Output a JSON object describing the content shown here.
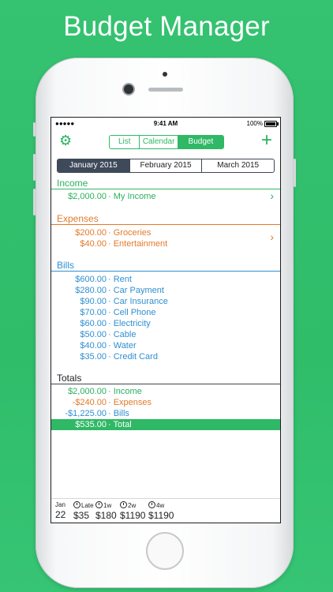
{
  "headline": "Budget Manager",
  "status_bar": {
    "signal": "●●●●● ",
    "time": "9:41 AM",
    "battery": "100%"
  },
  "toolbar": {
    "segments": [
      "List",
      "Calendar",
      "Budget"
    ],
    "active_segment": "Budget",
    "settings_icon": "gear-icon",
    "add_icon": "plus-icon"
  },
  "months": [
    "January 2015",
    "February 2015",
    "March 2015"
  ],
  "active_month": "January 2015",
  "income": {
    "title": "Income",
    "items": [
      {
        "amount": "$2,000.00",
        "label": "· My Income"
      }
    ]
  },
  "expenses": {
    "title": "Expenses",
    "items": [
      {
        "amount": "$200.00",
        "label": "· Groceries"
      },
      {
        "amount": "$40.00",
        "label": "· Entertainment"
      }
    ]
  },
  "bills": {
    "title": "Bills",
    "items": [
      {
        "amount": "$600.00",
        "label": "· Rent"
      },
      {
        "amount": "$280.00",
        "label": "· Car Payment"
      },
      {
        "amount": "$90.00",
        "label": "· Car Insurance"
      },
      {
        "amount": "$70.00",
        "label": "· Cell Phone"
      },
      {
        "amount": "$60.00",
        "label": "· Electricity"
      },
      {
        "amount": "$50.00",
        "label": "· Cable"
      },
      {
        "amount": "$40.00",
        "label": "· Water"
      },
      {
        "amount": "$35.00",
        "label": "· Credit Card"
      }
    ]
  },
  "totals": {
    "title": "Totals",
    "items": [
      {
        "amount": "$2,000.00",
        "label": "· Income"
      },
      {
        "amount": "-$240.00",
        "label": "· Expenses"
      },
      {
        "amount": "-$1,225.00",
        "label": "· Bills"
      },
      {
        "amount": "$535.00",
        "label": "· Total"
      }
    ]
  },
  "bottom_bar": {
    "date": {
      "top": "Jan",
      "bottom": "22"
    },
    "columns": [
      {
        "top": "Late",
        "bottom": "$35"
      },
      {
        "top": "1w",
        "bottom": "$180"
      },
      {
        "top": "2w",
        "bottom": "$1190"
      },
      {
        "top": "4w",
        "bottom": "$1190"
      }
    ]
  },
  "colors": {
    "green": "#2fb865",
    "orange": "#e27a2a",
    "blue": "#2f8fd0",
    "background": "#35c271"
  }
}
